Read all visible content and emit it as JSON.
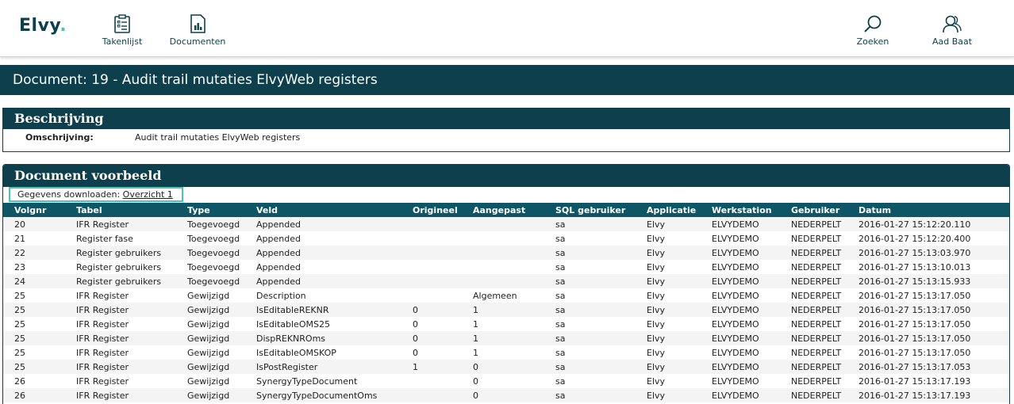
{
  "nav": {
    "logo": "Elvy",
    "logo_dot": ".",
    "items": [
      {
        "label": "Takenlijst",
        "icon": "clipboard-list-icon"
      },
      {
        "label": "Documenten",
        "icon": "document-chart-icon"
      },
      {
        "label": "Zoeken",
        "icon": "search-icon"
      },
      {
        "label": "Aad Baat",
        "icon": "user-icon"
      }
    ]
  },
  "page": {
    "title": "Document: 19 - Audit trail mutaties ElvyWeb registers"
  },
  "description": {
    "header": "Beschrijving",
    "label": "Omschrijving:",
    "value": "Audit trail mutaties ElvyWeb registers"
  },
  "preview": {
    "header": "Document voorbeeld",
    "download_label": "Gegevens downloaden:",
    "download_link": "Overzicht 1",
    "columns": [
      "Volgnr",
      "Tabel",
      "Type",
      "Veld",
      "Origineel",
      "Aangepast",
      "SQL gebruiker",
      "Applicatie",
      "Werkstation",
      "Gebruiker",
      "Datum"
    ],
    "rows": [
      [
        "20",
        "IFR Register",
        "Toegevoegd",
        "Appended",
        "",
        "",
        "sa",
        "Elvy",
        "ELVYDEMO",
        "NEDERPELT",
        "2016-01-27 15:12:20.110"
      ],
      [
        "21",
        "Register fase",
        "Toegevoegd",
        "Appended",
        "",
        "",
        "sa",
        "Elvy",
        "ELVYDEMO",
        "NEDERPELT",
        "2016-01-27 15:12:20.400"
      ],
      [
        "22",
        "Register gebruikers",
        "Toegevoegd",
        "Appended",
        "",
        "",
        "sa",
        "Elvy",
        "ELVYDEMO",
        "NEDERPELT",
        "2016-01-27 15:13:03.970"
      ],
      [
        "23",
        "Register gebruikers",
        "Toegevoegd",
        "Appended",
        "",
        "",
        "sa",
        "Elvy",
        "ELVYDEMO",
        "NEDERPELT",
        "2016-01-27 15:13:10.013"
      ],
      [
        "24",
        "Register gebruikers",
        "Toegevoegd",
        "Appended",
        "",
        "",
        "sa",
        "Elvy",
        "ELVYDEMO",
        "NEDERPELT",
        "2016-01-27 15:13:15.933"
      ],
      [
        "25",
        "IFR Register",
        "Gewijzigd",
        "Description",
        "",
        "Algemeen",
        "sa",
        "Elvy",
        "ELVYDEMO",
        "NEDERPELT",
        "2016-01-27 15:13:17.050"
      ],
      [
        "25",
        "IFR Register",
        "Gewijzigd",
        "IsEditableREKNR",
        "0",
        "1",
        "sa",
        "Elvy",
        "ELVYDEMO",
        "NEDERPELT",
        "2016-01-27 15:13:17.050"
      ],
      [
        "25",
        "IFR Register",
        "Gewijzigd",
        "IsEditableOMS25",
        "0",
        "1",
        "sa",
        "Elvy",
        "ELVYDEMO",
        "NEDERPELT",
        "2016-01-27 15:13:17.050"
      ],
      [
        "25",
        "IFR Register",
        "Gewijzigd",
        "DispREKNROms",
        "0",
        "1",
        "sa",
        "Elvy",
        "ELVYDEMO",
        "NEDERPELT",
        "2016-01-27 15:13:17.050"
      ],
      [
        "25",
        "IFR Register",
        "Gewijzigd",
        "IsEditableOMSKOP",
        "0",
        "1",
        "sa",
        "Elvy",
        "ELVYDEMO",
        "NEDERPELT",
        "2016-01-27 15:13:17.050"
      ],
      [
        "25",
        "IFR Register",
        "Gewijzigd",
        "IsPostRegister",
        "1",
        "0",
        "sa",
        "Elvy",
        "ELVYDEMO",
        "NEDERPELT",
        "2016-01-27 15:13:17.053"
      ],
      [
        "26",
        "IFR Register",
        "Gewijzigd",
        "SynergyTypeDocument",
        "",
        "0",
        "sa",
        "Elvy",
        "ELVYDEMO",
        "NEDERPELT",
        "2016-01-27 15:13:17.193"
      ],
      [
        "26",
        "IFR Register",
        "Gewijzigd",
        "SynergyTypeDocumentOms",
        "",
        "0",
        "sa",
        "Elvy",
        "ELVYDEMO",
        "NEDERPELT",
        "2016-01-27 15:13:17.193"
      ]
    ]
  }
}
